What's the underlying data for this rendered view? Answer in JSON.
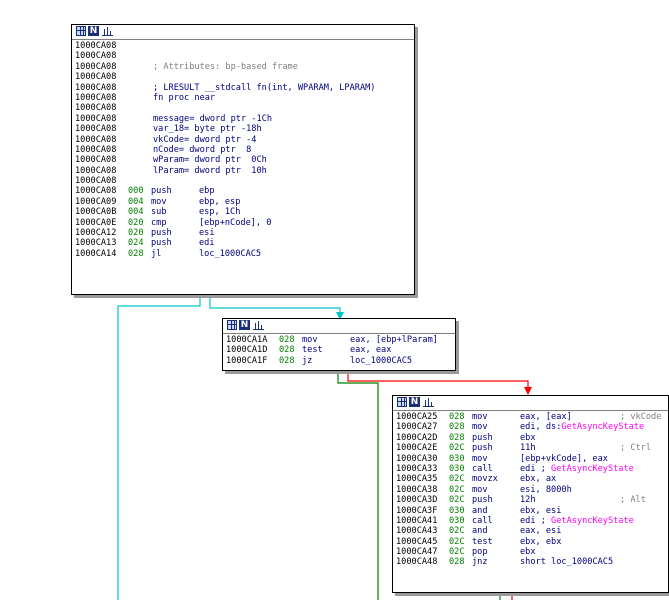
{
  "colors": {
    "edge_unconditional": "#00c8c8",
    "edge_true": "#008000",
    "edge_false": "#ff0000",
    "address": "#000000",
    "stack_pointer": "#008000",
    "instruction": "#000080",
    "comment": "#808080",
    "import_function": "#ff00ff"
  },
  "icons": [
    "grid-icon",
    "n-icon",
    "bar-chart-icon"
  ],
  "header_label": "N",
  "node1": {
    "lines": [
      {
        "addr": "1000CA08"
      },
      {
        "addr": "1000CA08"
      },
      {
        "addr": "1000CA08",
        "cm": "; Attributes: bp-based frame"
      },
      {
        "addr": "1000CA08"
      },
      {
        "addr": "1000CA08",
        "op": "; LRESULT __stdcall fn(int, WPARAM, LPARAM)"
      },
      {
        "addr": "1000CA08",
        "op": "fn proc near"
      },
      {
        "addr": "1000CA08"
      },
      {
        "addr": "1000CA08",
        "op": "message= dword ptr -1Ch"
      },
      {
        "addr": "1000CA08",
        "op": "var_18= byte ptr -18h"
      },
      {
        "addr": "1000CA08",
        "op": "vkCode= dword ptr -4"
      },
      {
        "addr": "1000CA08",
        "op": "nCode= dword ptr  8"
      },
      {
        "addr": "1000CA08",
        "op": "wParam= dword ptr  0Ch"
      },
      {
        "addr": "1000CA08",
        "op": "lParam= dword ptr  10h"
      },
      {
        "addr": "1000CA08"
      },
      {
        "addr": "1000CA08",
        "sp": "000",
        "mn": "push",
        "op": "ebp"
      },
      {
        "addr": "1000CA09",
        "sp": "004",
        "mn": "mov",
        "op": "ebp, esp"
      },
      {
        "addr": "1000CA0B",
        "sp": "004",
        "mn": "sub",
        "op": "esp, 1Ch"
      },
      {
        "addr": "1000CA0E",
        "sp": "020",
        "mn": "cmp",
        "op": "[ebp+nCode], 0"
      },
      {
        "addr": "1000CA12",
        "sp": "020",
        "mn": "push",
        "op": "esi"
      },
      {
        "addr": "1000CA13",
        "sp": "024",
        "mn": "push",
        "op": "edi"
      },
      {
        "addr": "1000CA14",
        "sp": "028",
        "mn": "jl",
        "op": "loc_1000CAC5"
      }
    ]
  },
  "node2": {
    "lines": [
      {
        "addr": "1000CA1A",
        "sp": "028",
        "mn": "mov",
        "op": "eax, [ebp+lParam]"
      },
      {
        "addr": "1000CA1D",
        "sp": "028",
        "mn": "test",
        "op": "eax, eax"
      },
      {
        "addr": "1000CA1F",
        "sp": "028",
        "mn": "jz",
        "op": "loc_1000CAC5"
      }
    ]
  },
  "node3": {
    "lines": [
      {
        "addr": "1000CA25",
        "sp": "028",
        "mn": "mov",
        "op": "eax, [eax]",
        "cm": "; vkCode"
      },
      {
        "addr": "1000CA27",
        "sp": "028",
        "mn": "mov",
        "op": "edi, ds:",
        "fn": "GetAsyncKeyState"
      },
      {
        "addr": "1000CA2D",
        "sp": "028",
        "mn": "push",
        "op": "ebx"
      },
      {
        "addr": "1000CA2E",
        "sp": "02C",
        "mn": "push",
        "op": "11h",
        "cm": "; Ctrl"
      },
      {
        "addr": "1000CA30",
        "sp": "030",
        "mn": "mov",
        "op": "[ebp+vkCode], eax"
      },
      {
        "addr": "1000CA33",
        "sp": "030",
        "mn": "call",
        "op": "edi ; ",
        "fn": "GetAsyncKeyState"
      },
      {
        "addr": "1000CA35",
        "sp": "02C",
        "mn": "movzx",
        "op": "ebx, ax"
      },
      {
        "addr": "1000CA38",
        "sp": "02C",
        "mn": "mov",
        "op": "esi, 8000h"
      },
      {
        "addr": "1000CA3D",
        "sp": "02C",
        "mn": "push",
        "op": "12h",
        "cm": "; Alt"
      },
      {
        "addr": "1000CA3F",
        "sp": "030",
        "mn": "and",
        "op": "ebx, esi"
      },
      {
        "addr": "1000CA41",
        "sp": "030",
        "mn": "call",
        "op": "edi ; ",
        "fn": "GetAsyncKeyState"
      },
      {
        "addr": "1000CA43",
        "sp": "02C",
        "mn": "and",
        "op": "eax, esi"
      },
      {
        "addr": "1000CA45",
        "sp": "02C",
        "mn": "test",
        "op": "ebx, ebx"
      },
      {
        "addr": "1000CA47",
        "sp": "02C",
        "mn": "pop",
        "op": "ebx"
      },
      {
        "addr": "1000CA48",
        "sp": "028",
        "mn": "jnz",
        "op": "short loc_1000CAC5"
      }
    ]
  }
}
